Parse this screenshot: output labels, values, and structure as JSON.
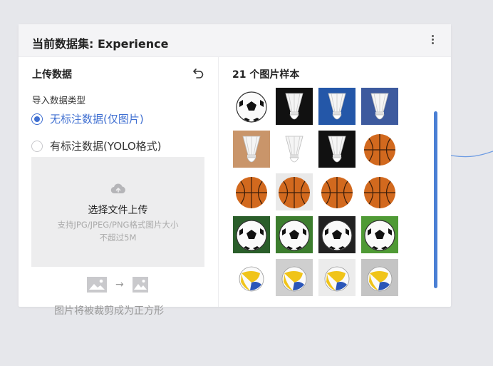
{
  "panel": {
    "title": "当前数据集: Experience",
    "more_icon": "more-vertical-icon"
  },
  "upload": {
    "title": "上传数据",
    "undo_icon": "undo-icon",
    "import_type_label": "导入数据类型",
    "options": [
      {
        "label": "无标注数据(仅图片)",
        "selected": true
      },
      {
        "label": "有标注数据(YOLO格式)",
        "selected": false
      }
    ],
    "dropzone": {
      "icon": "cloud-upload-icon",
      "title": "选择文件上传",
      "hint_line1": "支持JPG/JPEG/PNG格式图片大小",
      "hint_line2": "不超过5M"
    },
    "crop_note": "图片将被裁剪成为正方形"
  },
  "samples": {
    "title": "21 个图片样本",
    "items": [
      {
        "kind": "soccer",
        "bg": "#ffffff"
      },
      {
        "kind": "shuttlecock",
        "bg": "#111111"
      },
      {
        "kind": "shuttlecock",
        "bg": "#2457a8"
      },
      {
        "kind": "shuttlecock",
        "bg": "#3d5a9e"
      },
      {
        "kind": "shuttlecock",
        "bg": "#c9956a"
      },
      {
        "kind": "shuttlecock",
        "bg": "#ffffff"
      },
      {
        "kind": "shuttlecock",
        "bg": "#111111"
      },
      {
        "kind": "basketball",
        "bg": "#ffffff"
      },
      {
        "kind": "basketball",
        "bg": "#ffffff"
      },
      {
        "kind": "basketball",
        "bg": "#e9e9e9"
      },
      {
        "kind": "basketball",
        "bg": "#ffffff"
      },
      {
        "kind": "basketball",
        "bg": "#ffffff"
      },
      {
        "kind": "soccer",
        "bg": "#2a5e2a"
      },
      {
        "kind": "soccer",
        "bg": "#3c7d2e"
      },
      {
        "kind": "soccer",
        "bg": "#222222"
      },
      {
        "kind": "soccer",
        "bg": "#4f9a35"
      },
      {
        "kind": "volleyball",
        "bg": "#ffffff"
      },
      {
        "kind": "volleyball",
        "bg": "#cfcfcf"
      },
      {
        "kind": "volleyball",
        "bg": "#ececec"
      },
      {
        "kind": "volleyball",
        "bg": "#c4c4c4"
      }
    ]
  },
  "colors": {
    "accent": "#3f6fd1",
    "scrollbar": "#4a7fd4",
    "connector": "#6c9be3"
  }
}
